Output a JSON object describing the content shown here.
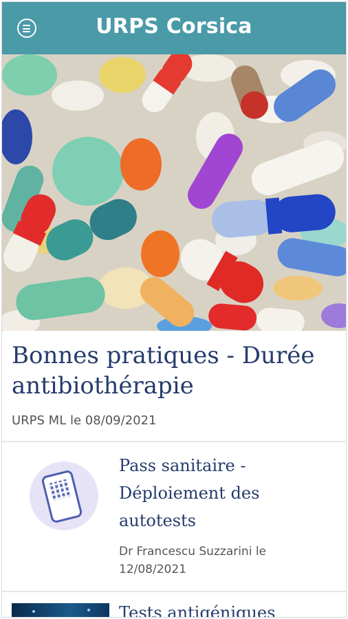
{
  "app": {
    "title": "URPS Corsica",
    "menu_icon": "hamburger-menu-icon"
  },
  "colors": {
    "header": "#4a9aa8",
    "title_text": "#243b6b",
    "meta_text": "#555555"
  },
  "featured_article": {
    "image": "colorful-pills-photo",
    "title": "Bonnes pratiques - Durée antibiothérapie",
    "meta": "URPS ML le 08/09/2021"
  },
  "articles": [
    {
      "thumbnail": "tous-anticovid-phone-illustration",
      "title": "Pass sanitaire - Déploiement des autotests",
      "meta": "Dr Francescu Suzzarini le 12/08/2021"
    },
    {
      "thumbnail": "network-tech-illustration",
      "title": "Tests antigéniques"
    }
  ]
}
